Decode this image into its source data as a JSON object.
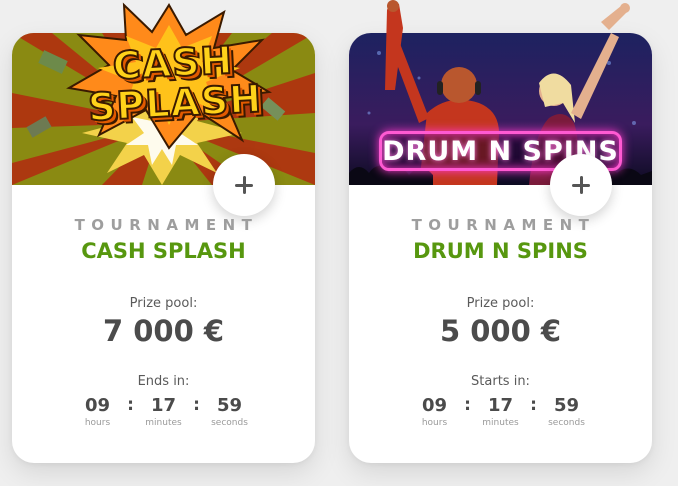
{
  "tournaments": [
    {
      "kicker": "TOURNAMENT",
      "art_title": "CASH SPLASH",
      "art_line1": "CASH",
      "art_line2": "SPLASH",
      "name": "CASH SPLASH",
      "prize_label": "Prize pool:",
      "prize_value": "7 000 €",
      "timer_label": "Ends in:",
      "timer": {
        "hours": "09",
        "minutes": "17",
        "seconds": "59"
      },
      "timer_units": {
        "hours": "hours",
        "minutes": "minutes",
        "seconds": "seconds"
      },
      "icon": "plus-icon"
    },
    {
      "kicker": "TOURNAMENT",
      "art_title": "DRUM N SPINS",
      "name": "DRUM N SPINS",
      "prize_label": "Prize pool:",
      "prize_value": "5 000 €",
      "timer_label": "Starts in:",
      "timer": {
        "hours": "09",
        "minutes": "17",
        "seconds": "59"
      },
      "timer_units": {
        "hours": "hours",
        "minutes": "minutes",
        "seconds": "seconds"
      },
      "icon": "plus-icon"
    }
  ],
  "colors": {
    "page_bg": "#efefef",
    "title_green": "#57970f",
    "kicker_gray": "#9e9e9e",
    "value_dark": "#4b4b4b"
  }
}
